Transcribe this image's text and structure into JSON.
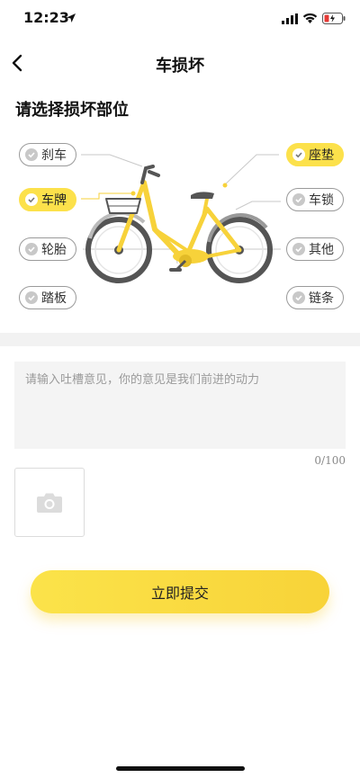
{
  "status_bar": {
    "time": "12:23"
  },
  "nav": {
    "title": "车损坏"
  },
  "section_title": "请选择损坏部位",
  "parts": {
    "brake": {
      "label": "刹车",
      "selected": false
    },
    "plate": {
      "label": "车牌",
      "selected": true
    },
    "tire": {
      "label": "轮胎",
      "selected": false
    },
    "pedal": {
      "label": "踏板",
      "selected": false
    },
    "seat": {
      "label": "座垫",
      "selected": true
    },
    "lock": {
      "label": "车锁",
      "selected": false
    },
    "other": {
      "label": "其他",
      "selected": false
    },
    "chain": {
      "label": "链条",
      "selected": false
    }
  },
  "feedback": {
    "placeholder": "请输入吐槽意见，你的意见是我们前进的动力",
    "value": "",
    "counter": "0/100"
  },
  "submit_label": "立即提交",
  "colors": {
    "accent": "#fce14b",
    "bike_yellow": "#f7d23a",
    "tire": "#555555"
  }
}
